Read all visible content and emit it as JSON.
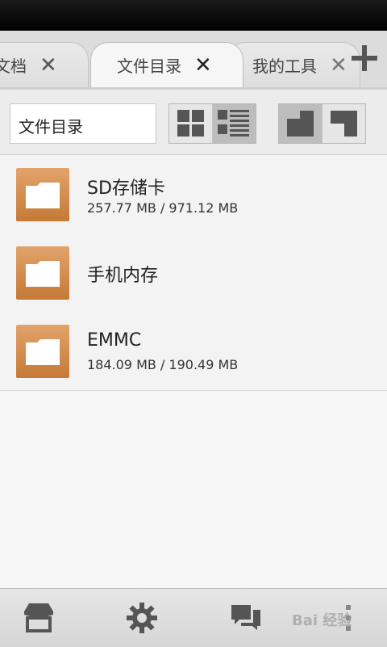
{
  "tabs": [
    {
      "label": "的文档",
      "close": "✕",
      "active": false
    },
    {
      "label": "文件目录",
      "close": "✕",
      "active": true
    },
    {
      "label": "我的工具",
      "close": "✕",
      "active": false
    }
  ],
  "tab_add_icon": "plus-icon",
  "toolbar": {
    "path": "文件目录",
    "view_modes": [
      "grid-view-icon",
      "list-view-icon"
    ],
    "selected_view": "list",
    "pane_modes": [
      "single-pane-icon",
      "dual-pane-icon"
    ],
    "selected_pane": "single"
  },
  "storage": [
    {
      "name": "SD存储卡",
      "usage": "257.77 MB / 971.12 MB",
      "icon": "folder-icon"
    },
    {
      "name": "手机内存",
      "usage": "",
      "icon": "folder-icon"
    },
    {
      "name": "EMMC",
      "usage": "184.09 MB / 190.49 MB",
      "icon": "folder-icon"
    }
  ],
  "bottom_nav": [
    "store-icon",
    "settings-gear-icon",
    "chat-icon",
    "more-vertical-icon"
  ],
  "watermark": "Bai 经验",
  "colors": {
    "folder_top": "#e2a36b",
    "folder_bottom": "#c57a36",
    "selected_button": "#bdbdbd"
  }
}
